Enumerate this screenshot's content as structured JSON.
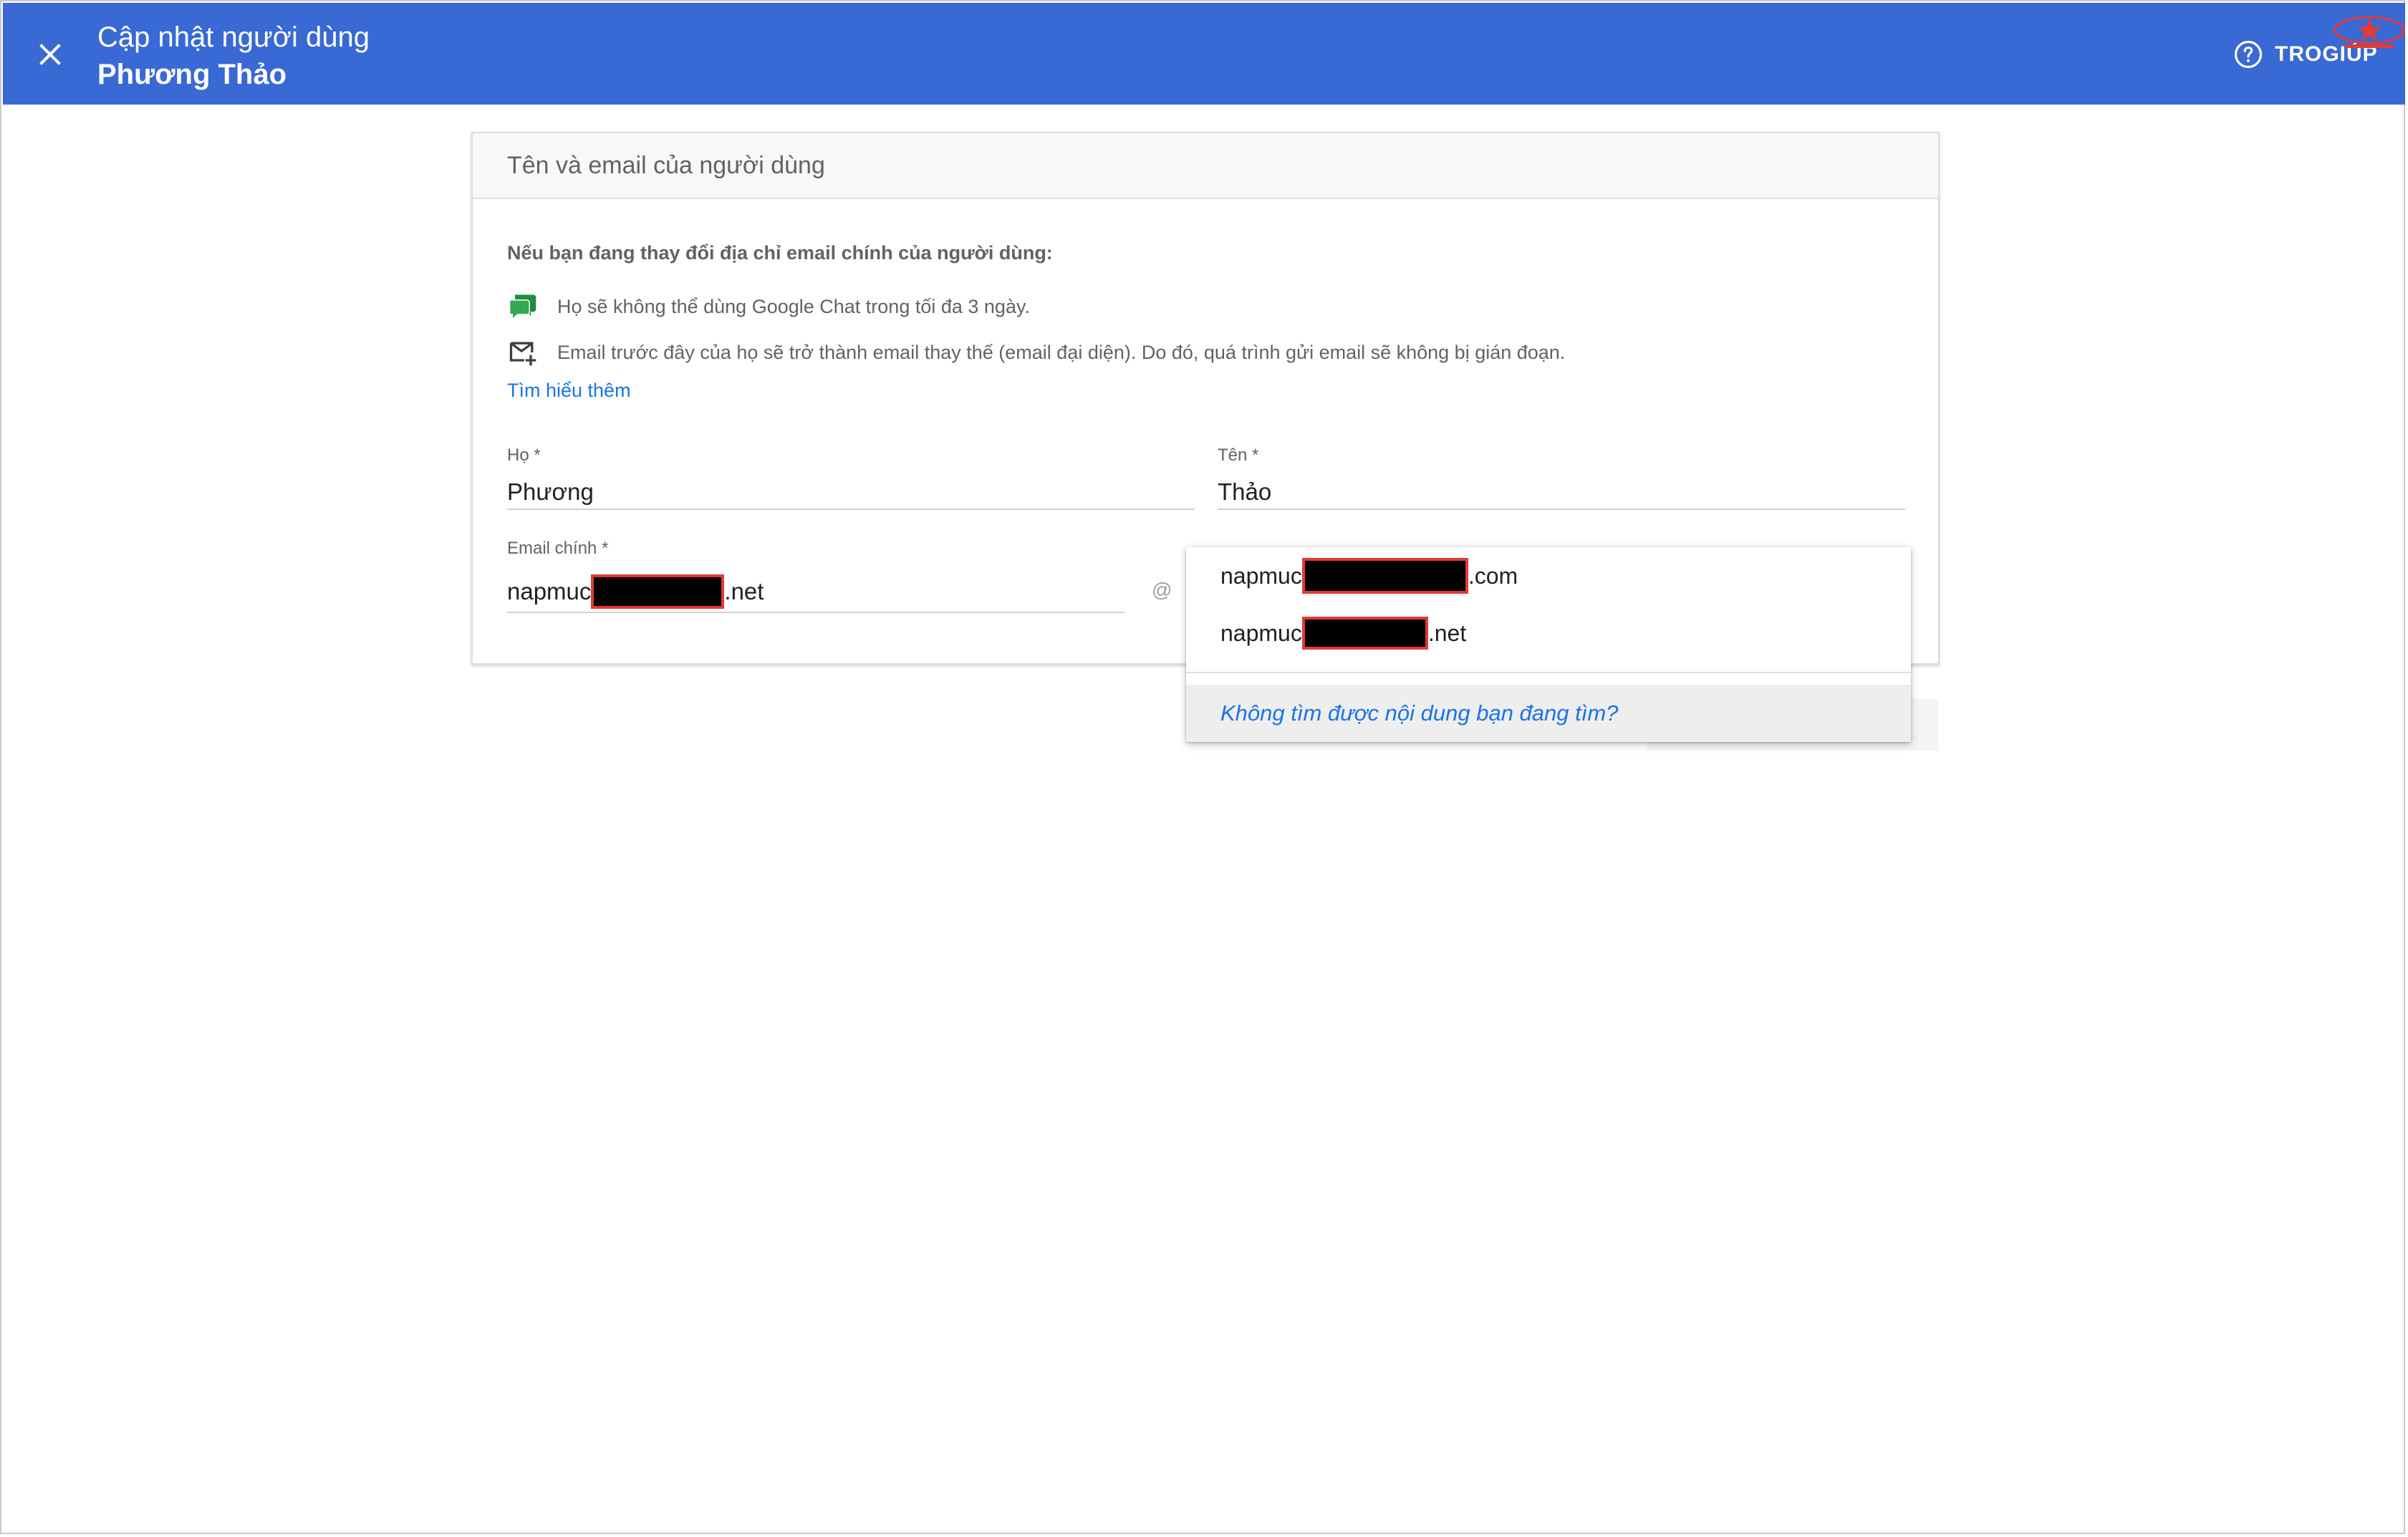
{
  "header": {
    "title": "Cập nhật người dùng",
    "subtitle": "Phương Thảo",
    "help_label": "TROGIÚP",
    "background_color": "#3869d4"
  },
  "card": {
    "title": "Tên và email của người dùng",
    "notice_heading": "Nếu bạn đang thay đổi địa chỉ email chính của người dùng:",
    "notices": [
      {
        "icon": "google-chat-icon",
        "text": "Họ sẽ không thể dùng Google Chat trong tối đa 3 ngày."
      },
      {
        "icon": "mail-add-icon",
        "text": "Email trước đây của họ sẽ trở thành email thay thế (email đại diện). Do đó, quá trình gửi email sẽ không bị gián đoạn."
      }
    ],
    "learn_more": "Tìm hiểu thêm"
  },
  "form": {
    "last_name_label": "Họ *",
    "last_name_value": "Phương",
    "first_name_label": "Tên *",
    "first_name_value": "Thảo",
    "email_label": "Email chính *",
    "email_prefix": "napmuc",
    "email_suffix": ".net",
    "at_sign": "@"
  },
  "domain_dropdown": {
    "options": [
      {
        "prefix": "napmuc",
        "suffix": ".com"
      },
      {
        "prefix": "napmuc",
        "suffix": ".net"
      }
    ],
    "footer": "Không tìm được nội dung bạn đang tìm?"
  },
  "colors": {
    "accent": "#3869d4",
    "link": "#1a73e8",
    "redaction_border": "#e53935"
  }
}
